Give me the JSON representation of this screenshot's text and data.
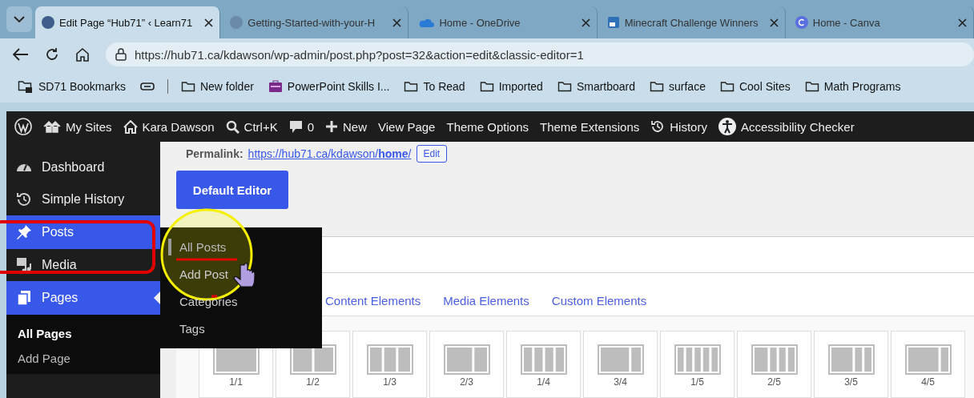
{
  "browser": {
    "tabs": [
      {
        "title": "Edit Page “Hub71” ‹ Learn71",
        "selected": true
      },
      {
        "title": "Getting-Started-with-your-H",
        "selected": false
      },
      {
        "title": "Home - OneDrive",
        "selected": false
      },
      {
        "title": "Minecraft Challenge Winners",
        "selected": false
      },
      {
        "title": "Home - Canva",
        "selected": false
      }
    ],
    "address": "https://hub71.ca/kdawson/wp-admin/post.php?post=32&action=edit&classic-editor=1",
    "bookmarks": [
      {
        "kind": "folder",
        "label": "SD71 Bookmarks"
      },
      {
        "kind": "icon"
      },
      {
        "kind": "folder",
        "label": "New folder"
      },
      {
        "kind": "site",
        "label": "PowerPoint Skills I..."
      },
      {
        "kind": "folder",
        "label": "To Read"
      },
      {
        "kind": "folder",
        "label": "Imported"
      },
      {
        "kind": "folder",
        "label": "Smartboard"
      },
      {
        "kind": "folder",
        "label": "surface"
      },
      {
        "kind": "folder",
        "label": "Cool Sites"
      },
      {
        "kind": "folder",
        "label": "Math Programs"
      }
    ]
  },
  "admin_bar": {
    "items": [
      {
        "label": "My Sites"
      },
      {
        "label": "Kara Dawson"
      },
      {
        "label": "Ctrl+K"
      },
      {
        "label": "0"
      },
      {
        "label": "New"
      },
      {
        "label": "View Page"
      },
      {
        "label": "Theme Options"
      },
      {
        "label": "Theme Extensions"
      },
      {
        "label": "History"
      },
      {
        "label": "Accessibility Checker"
      }
    ]
  },
  "sidebar": {
    "items": [
      {
        "label": "Dashboard",
        "highlighted": false,
        "current": false
      },
      {
        "label": "Simple History",
        "highlighted": false,
        "current": false
      },
      {
        "label": "Posts",
        "highlighted": true,
        "current": false
      },
      {
        "label": "Media",
        "highlighted": false,
        "current": false
      },
      {
        "label": "Pages",
        "highlighted": true,
        "current": true,
        "children": [
          {
            "label": "All Pages",
            "selected": true
          },
          {
            "label": "Add Page",
            "selected": false
          }
        ]
      }
    ]
  },
  "flyout": {
    "items": [
      {
        "label": "All Posts",
        "selected": true
      },
      {
        "label": "Add Post",
        "selected": false
      },
      {
        "label": "Categories",
        "selected": false
      },
      {
        "label": "Tags",
        "selected": false
      }
    ]
  },
  "editor": {
    "permalink_label": "Permalink:",
    "permalink": "https://hub71.ca/kdawson/**home**/",
    "edit_button": "Edit",
    "default_editor_button": "Default Editor",
    "element_tabs": [
      "Content Elements",
      "Media Elements",
      "Custom Elements"
    ],
    "layouts": [
      {
        "label": "1/1",
        "kind": "full"
      },
      {
        "label": "1/2",
        "kind": "halves"
      },
      {
        "label": "1/3",
        "kind": "thirds"
      },
      {
        "label": "2/3",
        "kind": "two-thirds"
      },
      {
        "label": "1/4",
        "kind": "quarters"
      },
      {
        "label": "3/4",
        "kind": "three-quarters"
      },
      {
        "label": "1/5",
        "kind": "fifths"
      },
      {
        "label": "2/5",
        "kind": "two-fifths"
      },
      {
        "label": "3/5",
        "kind": "three-fifths"
      },
      {
        "label": "4/5",
        "kind": "four-fifths"
      }
    ]
  }
}
